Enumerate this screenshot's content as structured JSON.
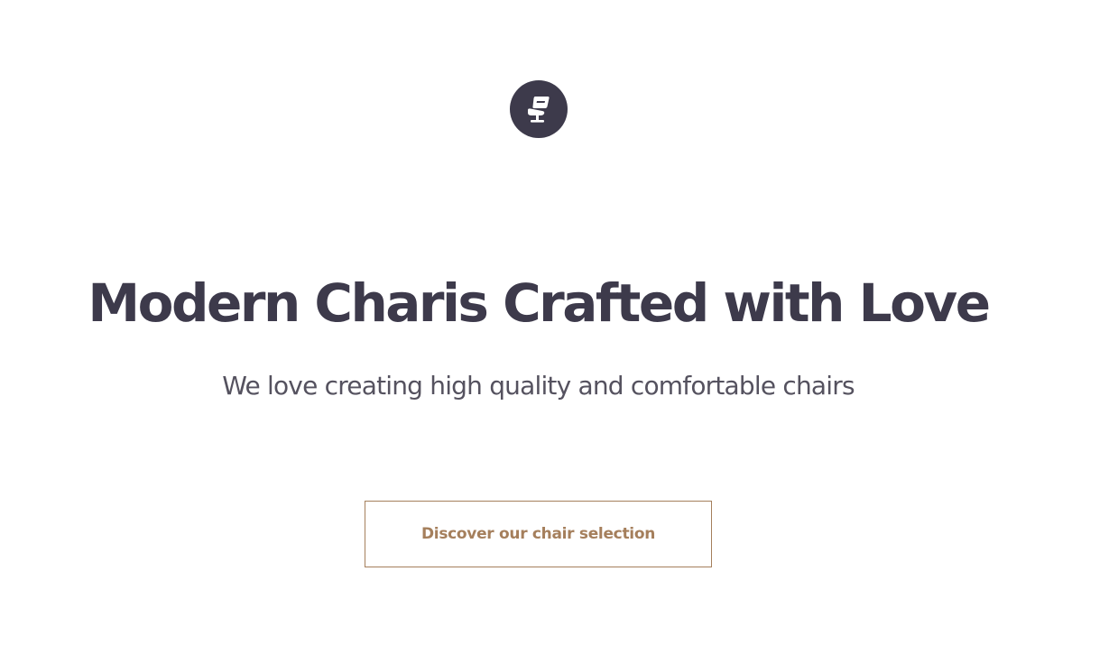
{
  "brand": {
    "logo_icon": "chair-icon",
    "logo_color": "#3d3a4b"
  },
  "hero": {
    "headline": "Modern Charis Crafted with Love",
    "subtitle": "We love creating high quality and comfortable chairs",
    "cta_label": "Discover our chair selection"
  },
  "colors": {
    "text_dark": "#3d3a4b",
    "text_muted": "#55525f",
    "accent": "#a57f5c",
    "background": "#ffffff"
  }
}
